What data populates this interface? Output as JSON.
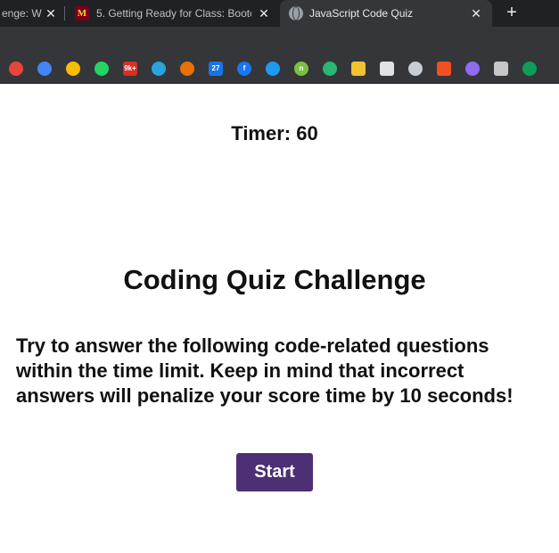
{
  "browser": {
    "tabs": [
      {
        "title": "enge: W",
        "active": false
      },
      {
        "title": "5. Getting Ready for Class: Bootc",
        "icon_text": "M",
        "active": false
      },
      {
        "title": "JavaScript Code Quiz",
        "active": true
      }
    ],
    "close_glyph": "✕",
    "new_tab_glyph": "+",
    "bookmarks": [
      {
        "name": "chrome-icon",
        "color": "#e8453c",
        "text": ""
      },
      {
        "name": "messages-icon",
        "color": "#4285f4",
        "text": ""
      },
      {
        "name": "keep-icon",
        "color": "#fbbc04",
        "text": ""
      },
      {
        "name": "whatsapp-icon",
        "color": "#25d366",
        "text": ""
      },
      {
        "name": "gmail-icon",
        "color": "#d93025",
        "text": "9k+"
      },
      {
        "name": "telegram-icon",
        "color": "#2aa3df",
        "text": ""
      },
      {
        "name": "star-icon",
        "color": "#e8710a",
        "text": ""
      },
      {
        "name": "calendar-icon",
        "color": "#1a73e8",
        "text": "27"
      },
      {
        "name": "facebook-icon",
        "color": "#1877f2",
        "text": "f"
      },
      {
        "name": "twitter-icon",
        "color": "#1d9bf0",
        "text": ""
      },
      {
        "name": "n-icon",
        "color": "#7ac143",
        "text": "n"
      },
      {
        "name": "shield-icon",
        "color": "#2bb673",
        "text": ""
      },
      {
        "name": "library-icon",
        "color": "#f1c232",
        "text": ""
      },
      {
        "name": "seal-icon",
        "color": "#dfe1e5",
        "text": ""
      },
      {
        "name": "dhs-icon",
        "color": "#c8cdd3",
        "text": ""
      },
      {
        "name": "microsoft-icon",
        "color": "#f25022",
        "text": ""
      },
      {
        "name": "sparkle-icon",
        "color": "#8e6cef",
        "text": ""
      },
      {
        "name": "pdf-icon",
        "color": "#c7c7c7",
        "text": ""
      },
      {
        "name": "pinecone-icon",
        "color": "#0f9d58",
        "text": ""
      }
    ]
  },
  "page": {
    "timer": "Timer: 60",
    "title": "Coding Quiz Challenge",
    "instructions": "Try to answer the following code-related questions within the time limit. Keep in mind that incorrect answers will penalize your score time by 10 seconds!",
    "start_label": "Start",
    "accent": "#4c2f74"
  }
}
